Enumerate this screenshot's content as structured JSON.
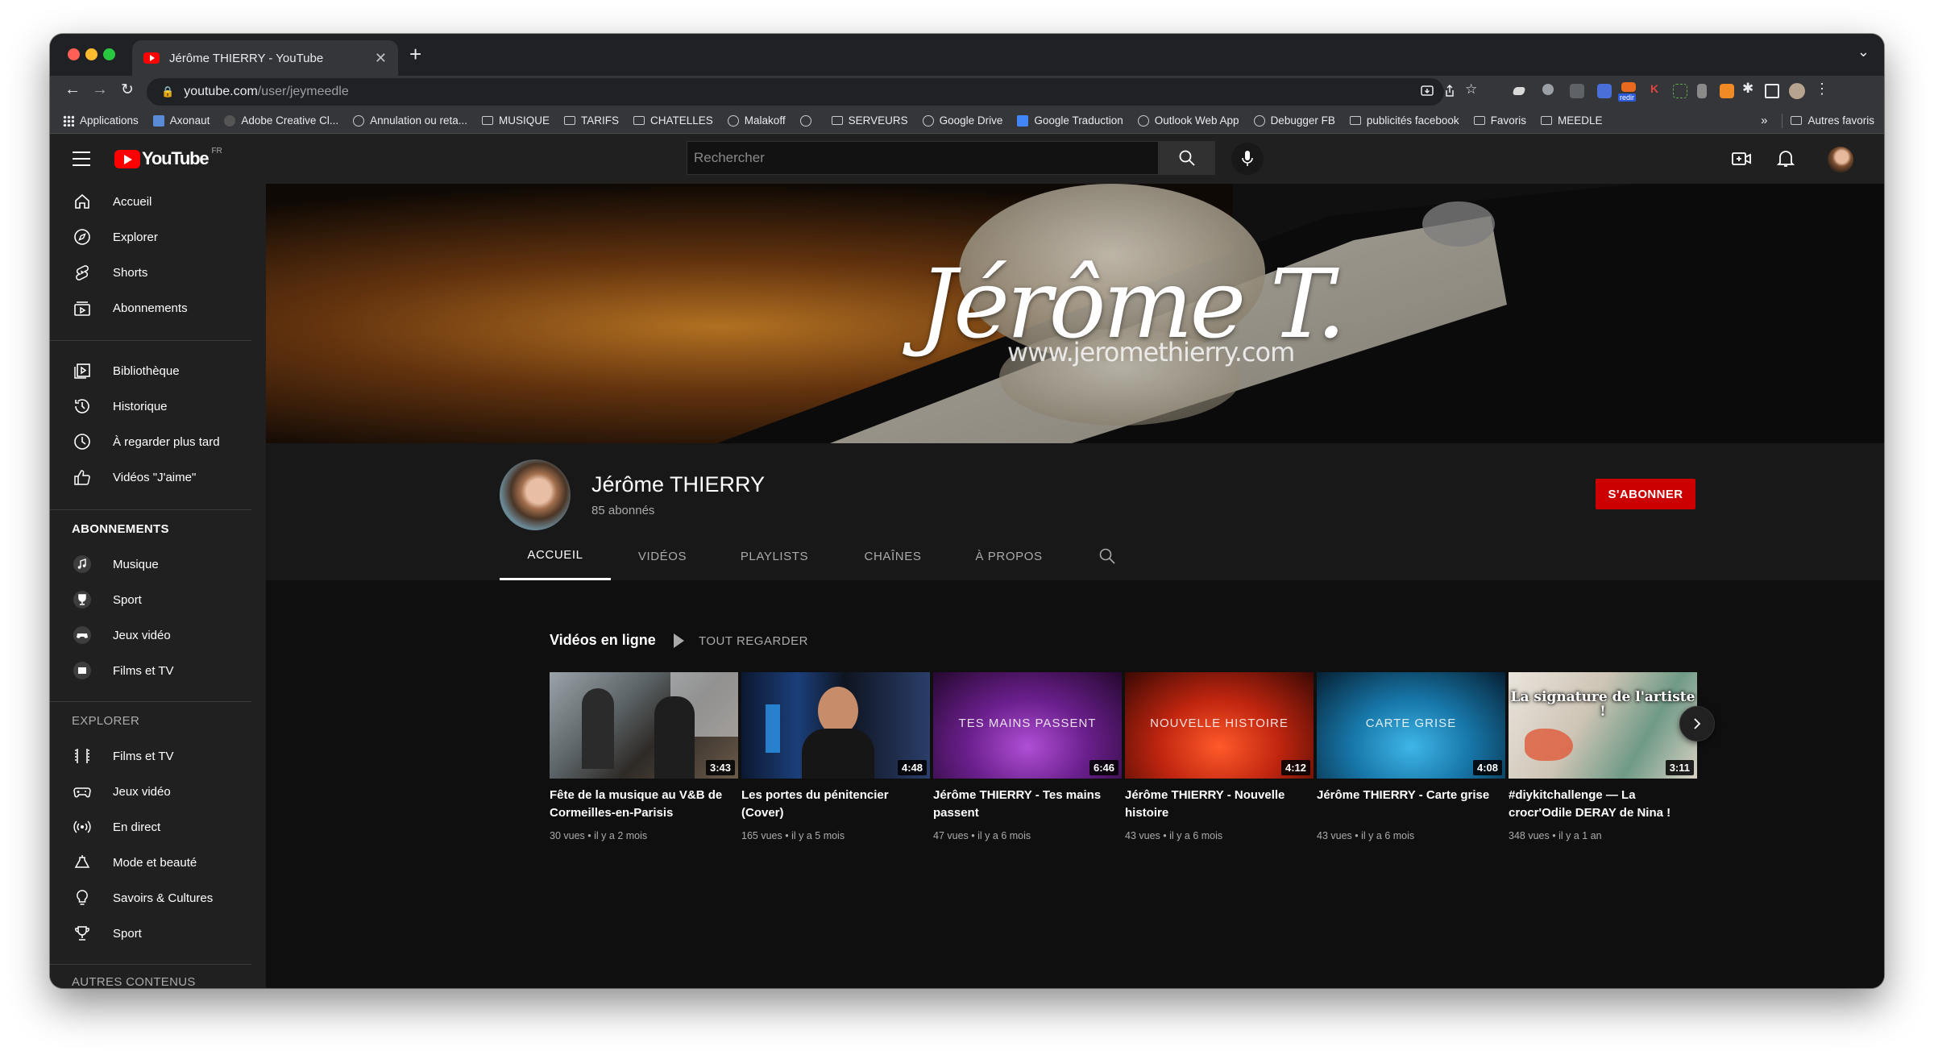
{
  "browser": {
    "tab_title": "Jérôme THIERRY - YouTube",
    "url_host": "youtube.com",
    "url_path": "/user/jeymeedle",
    "bookmarks": [
      {
        "label": "Applications",
        "icon": "apps-icon"
      },
      {
        "label": "Axonaut",
        "icon": "axonaut-icon"
      },
      {
        "label": "Adobe Creative Cl...",
        "icon": "adobe-icon"
      },
      {
        "label": "Annulation ou reta...",
        "icon": "globe-icon"
      },
      {
        "label": "MUSIQUE",
        "icon": "folder-icon"
      },
      {
        "label": "TARIFS",
        "icon": "folder-icon"
      },
      {
        "label": "CHATELLES",
        "icon": "folder-icon"
      },
      {
        "label": "Malakoff",
        "icon": "globe-icon"
      },
      {
        "label": "",
        "icon": "globe-icon"
      },
      {
        "label": "SERVEURS",
        "icon": "folder-icon"
      },
      {
        "label": "Google Drive",
        "icon": "globe-icon"
      },
      {
        "label": "Google Traduction",
        "icon": "translate-icon"
      },
      {
        "label": "Outlook Web App",
        "icon": "globe-icon"
      },
      {
        "label": "Debugger FB",
        "icon": "globe-icon"
      },
      {
        "label": "publicités facebook",
        "icon": "folder-icon"
      },
      {
        "label": "Favoris",
        "icon": "folder-icon"
      },
      {
        "label": "MEEDLE",
        "icon": "folder-icon"
      }
    ],
    "bookmarks_overflow": "»",
    "other_bookmarks": "Autres favoris",
    "ext_badge": "redir"
  },
  "youtube": {
    "logo_text": "YouTube",
    "country_code": "FR",
    "search_placeholder": "Rechercher",
    "sidebar": {
      "main": [
        {
          "label": "Accueil",
          "icon": "home-icon"
        },
        {
          "label": "Explorer",
          "icon": "compass-icon"
        },
        {
          "label": "Shorts",
          "icon": "shorts-icon"
        },
        {
          "label": "Abonnements",
          "icon": "subscriptions-icon"
        }
      ],
      "library": [
        {
          "label": "Bibliothèque",
          "icon": "library-icon"
        },
        {
          "label": "Historique",
          "icon": "history-icon"
        },
        {
          "label": "À regarder plus tard",
          "icon": "clock-icon"
        },
        {
          "label": "Vidéos \"J'aime\"",
          "icon": "thumbs-up-icon"
        }
      ],
      "subscriptions_title": "ABONNEMENTS",
      "subscriptions": [
        {
          "label": "Musique",
          "icon": "music-icon"
        },
        {
          "label": "Sport",
          "icon": "trophy-icon"
        },
        {
          "label": "Jeux vidéo",
          "icon": "gamepad-icon"
        },
        {
          "label": "Films et TV",
          "icon": "film-icon"
        }
      ],
      "explore_title": "EXPLORER",
      "explore": [
        {
          "label": "Films et TV",
          "icon": "film-strip-icon"
        },
        {
          "label": "Jeux vidéo",
          "icon": "gamepad-icon"
        },
        {
          "label": "En direct",
          "icon": "live-icon"
        },
        {
          "label": "Mode et beauté",
          "icon": "hanger-icon"
        },
        {
          "label": "Savoirs & Cultures",
          "icon": "lightbulb-icon"
        },
        {
          "label": "Sport",
          "icon": "trophy-icon"
        }
      ],
      "more_title": "AUTRES CONTENUS"
    },
    "banner": {
      "signature": "Jérôme T.",
      "website": "www.jeromethierry.com"
    },
    "channel": {
      "name": "Jérôme THIERRY",
      "subscribers": "85 abonnés",
      "subscribe_label": "S'ABONNER",
      "tabs": [
        "ACCUEIL",
        "VIDÉOS",
        "PLAYLISTS",
        "CHAÎNES",
        "À PROPOS"
      ],
      "active_tab": "ACCUEIL"
    },
    "section": {
      "title": "Vidéos en ligne",
      "play_all": "TOUT REGARDER"
    },
    "videos": [
      {
        "title": "Fête de la musique au V&B de Cormeilles-en-Parisis",
        "views": "30 vues",
        "age": "il y a 2 mois",
        "duration": "3:43",
        "overlay": ""
      },
      {
        "title": "Les portes du pénitencier (Cover)",
        "views": "165 vues",
        "age": "il y a 5 mois",
        "duration": "4:48",
        "overlay": ""
      },
      {
        "title": "Jérôme THIERRY - Tes mains passent",
        "views": "47 vues",
        "age": "il y a 6 mois",
        "duration": "6:46",
        "overlay": "TES MAINS PASSENT"
      },
      {
        "title": "Jérôme THIERRY - Nouvelle histoire",
        "views": "43 vues",
        "age": "il y a 6 mois",
        "duration": "4:12",
        "overlay": "NOUVELLE HISTOIRE"
      },
      {
        "title": "Jérôme THIERRY - Carte grise",
        "views": "43 vues",
        "age": "il y a 6 mois",
        "duration": "4:08",
        "overlay": "CARTE GRISE"
      },
      {
        "title": "#diykitchallenge — La crocr'Odile DERAY de Nina !",
        "views": "348 vues",
        "age": "il y a 1 an",
        "duration": "3:11",
        "overlay": "La signature de l'artiste !"
      }
    ],
    "meta_separator": "•"
  }
}
